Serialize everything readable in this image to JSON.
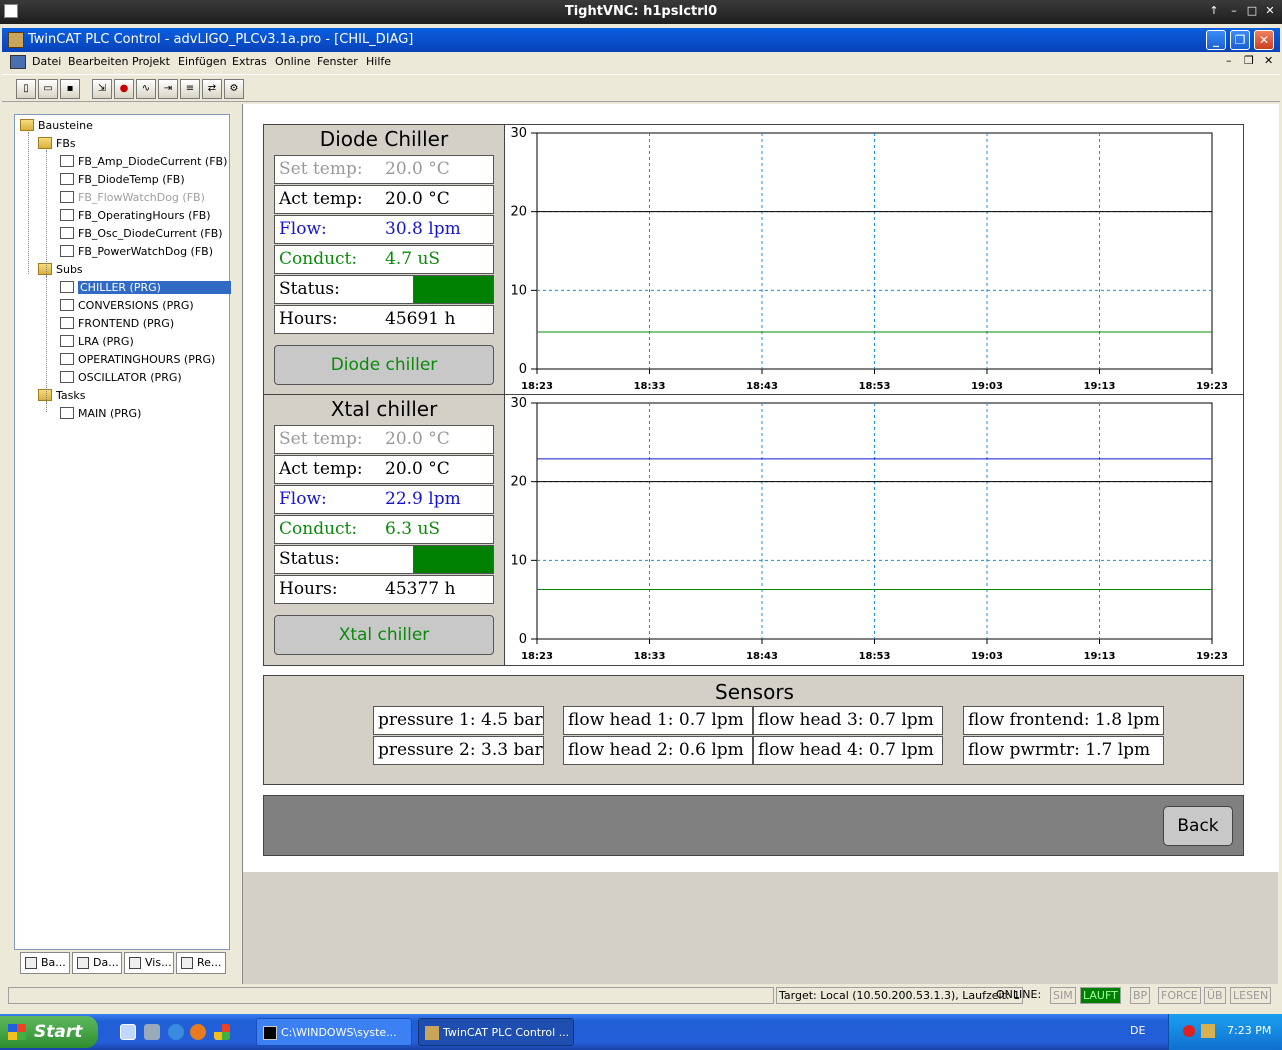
{
  "vnc": {
    "title": "TightVNC: h1psIctrl0",
    "controls": [
      "↑",
      "–",
      "□",
      "✕"
    ]
  },
  "app": {
    "title": "TwinCAT PLC Control - advLIGO_PLCv3.1a.pro - [CHIL_DIAG]",
    "buttons": {
      "minimize": "_",
      "restore": "❐",
      "close": "✕"
    }
  },
  "menu": {
    "items": [
      "Datei",
      "Bearbeiten",
      "Projekt",
      "Einfügen",
      "Extras",
      "Online",
      "Fenster",
      "Hilfe"
    ],
    "mdi_controls": [
      "–",
      "❐",
      "✕"
    ]
  },
  "toolbar": {
    "icons": [
      "new-icon",
      "open-icon",
      "save-icon",
      "login-icon",
      "stop-icon",
      "run-icon",
      "step-icon",
      "breakpoint-icon",
      "online-icon",
      "compile-icon"
    ]
  },
  "tree": {
    "root": "Bausteine",
    "fbs_label": "FBs",
    "fbs": [
      {
        "label": "FB_Amp_DiodeCurrent (FB)",
        "dim": false
      },
      {
        "label": "FB_DiodeTemp (FB)",
        "dim": false
      },
      {
        "label": "FB_FlowWatchDog (FB)",
        "dim": true
      },
      {
        "label": "FB_OperatingHours (FB)",
        "dim": false
      },
      {
        "label": "FB_Osc_DiodeCurrent (FB)",
        "dim": false
      },
      {
        "label": "FB_PowerWatchDog (FB)",
        "dim": false
      }
    ],
    "subs_label": "Subs",
    "subs": [
      "CHILLER (PRG)",
      "CONVERSIONS (PRG)",
      "FRONTEND (PRG)",
      "LRA (PRG)",
      "OPERATINGHOURS (PRG)",
      "OSCILLATOR (PRG)"
    ],
    "tasks_label": "Tasks",
    "tasks": [
      "MAIN (PRG)"
    ],
    "tabs": [
      "Ba...",
      "Da...",
      "Vis...",
      "Re..."
    ]
  },
  "diode": {
    "title": "Diode Chiller",
    "set_label": "Set temp:",
    "set_value": "20.0 °C",
    "act_label": "Act temp:",
    "act_value": "20.0 °C",
    "flow_label": "Flow:",
    "flow_value": "30.8 lpm",
    "cond_label": "Conduct:",
    "cond_value": "4.7 uS",
    "status_label": "Status:",
    "status_color": "#008000",
    "hours_label": "Hours:",
    "hours_value": "45691 h",
    "button": "Diode chiller"
  },
  "xtal": {
    "title": "Xtal chiller",
    "set_label": "Set temp:",
    "set_value": "20.0 °C",
    "act_label": "Act temp:",
    "act_value": "20.0 °C",
    "flow_label": "Flow:",
    "flow_value": "22.9 lpm",
    "cond_label": "Conduct:",
    "cond_value": "6.3 uS",
    "status_label": "Status:",
    "status_color": "#008000",
    "hours_label": "Hours:",
    "hours_value": "45377 h",
    "button": "Xtal chiller"
  },
  "chart_data": [
    {
      "type": "line",
      "x_ticks": [
        "18:23",
        "18:33",
        "18:43",
        "18:53",
        "19:03",
        "19:13",
        "19:23"
      ],
      "y_ticks": [
        0,
        10,
        20,
        30
      ],
      "ylim": [
        0,
        30
      ],
      "grid": true,
      "series": [
        {
          "color": "#000000",
          "values": [
            20.0,
            20.0,
            20.0,
            20.0,
            20.0,
            20.0,
            20.0
          ]
        },
        {
          "color": "#0a8a0a",
          "values": [
            4.7,
            4.7,
            4.7,
            4.7,
            4.7,
            4.7,
            4.7
          ]
        }
      ]
    },
    {
      "type": "line",
      "x_ticks": [
        "18:23",
        "18:33",
        "18:43",
        "18:53",
        "19:03",
        "19:13",
        "19:23"
      ],
      "y_ticks": [
        0,
        10,
        20,
        30
      ],
      "ylim": [
        0,
        30
      ],
      "grid": true,
      "series": [
        {
          "color": "#1414d2",
          "values": [
            22.9,
            22.9,
            22.9,
            22.9,
            22.9,
            22.9,
            22.9
          ]
        },
        {
          "color": "#000000",
          "values": [
            20.0,
            20.0,
            20.0,
            20.0,
            20.0,
            20.0,
            20.0
          ]
        },
        {
          "color": "#0a8a0a",
          "values": [
            6.3,
            6.3,
            6.3,
            6.3,
            6.3,
            6.3,
            6.3
          ]
        }
      ]
    }
  ],
  "sensors": {
    "title": "Sensors",
    "items": [
      "pressure 1:  4.5 bar",
      "pressure 2:  3.3 bar",
      "flow head 1:  0.7 lpm",
      "flow head 2:  0.6 lpm",
      "flow head 3:  0.7 lpm",
      "flow head 4:  0.7 lpm",
      "flow frontend:  1.8 lpm",
      "flow pwrmtr:  1.7 lpm"
    ]
  },
  "back_button": "Back",
  "status": {
    "target": "Target: Local (10.50.200.53.1.3), Laufzeit: 1",
    "online": "ONLINE:",
    "sim": "SIM",
    "lauf": "LAUFT",
    "bp": "BP",
    "force": "FORCE",
    "ub": "ÜB",
    "lesen": "LESEN"
  },
  "taskbar": {
    "start": "Start",
    "task1": "C:\\WINDOWS\\syste...",
    "task2": "TwinCAT PLC Control ...",
    "lang": "DE",
    "clock": "7:23 PM"
  }
}
